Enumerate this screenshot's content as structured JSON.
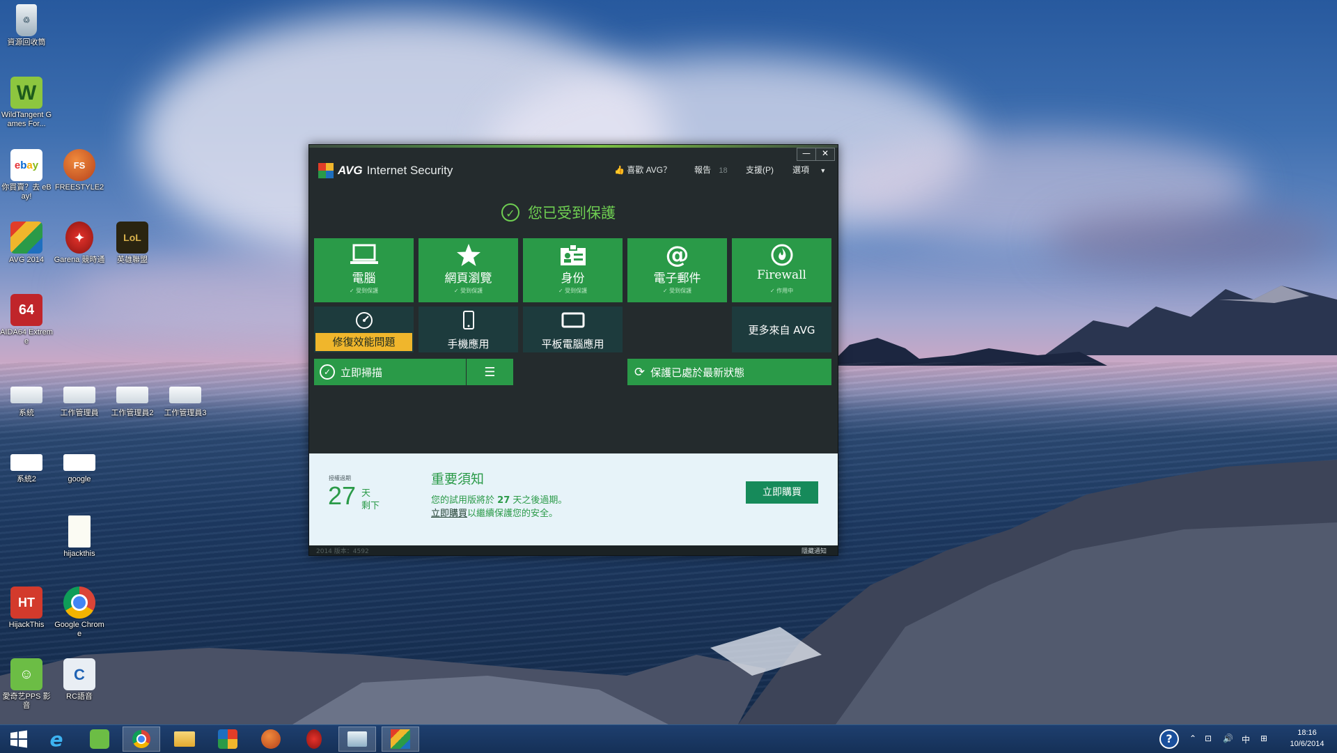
{
  "desktop_icons": [
    {
      "label": "資源回收筒",
      "icon": "recycle-bin-icon"
    },
    {
      "label": "WildTangent Games For...",
      "icon": "wildtangent-icon"
    },
    {
      "label": "你買賣？去 eBay!",
      "icon": "ebay-icon"
    },
    {
      "label": "FREESTYLE2",
      "icon": "freestyle-icon"
    },
    {
      "label": "AVG 2014",
      "icon": "avg-icon"
    },
    {
      "label": "Garena 競時通",
      "icon": "garena-icon"
    },
    {
      "label": "英雄聯盟",
      "icon": "league-icon"
    },
    {
      "label": "AIDA64 Extreme",
      "icon": "aida64-icon"
    },
    {
      "label": "系統",
      "icon": "shortcut-icon"
    },
    {
      "label": "工作管理員",
      "icon": "shortcut-icon"
    },
    {
      "label": "工作管理員2",
      "icon": "shortcut-icon"
    },
    {
      "label": "工作管理員3",
      "icon": "shortcut-icon"
    },
    {
      "label": "系統2",
      "icon": "shortcut-icon"
    },
    {
      "label": "google",
      "icon": "shortcut-icon"
    },
    {
      "label": "hijackthis",
      "icon": "text-file-icon"
    },
    {
      "label": "HijackThis",
      "icon": "hijackthis-icon"
    },
    {
      "label": "Google Chrome",
      "icon": "chrome-icon"
    },
    {
      "label": "愛奇艺PPS 影音",
      "icon": "iqiyi-icon"
    },
    {
      "label": "RC語音",
      "icon": "rc-icon"
    }
  ],
  "avg_window": {
    "brand": "AVG",
    "product": "Internet Security",
    "menu": {
      "like": "喜歡 AVG？",
      "reports": "報告",
      "reports_count": "18",
      "support": "支援(P)",
      "options": "選項"
    },
    "window_buttons": {
      "minimize": "—",
      "close": "✕"
    },
    "status": "您已受到保護",
    "tiles": [
      {
        "title": "電腦",
        "status": "受到保護",
        "icon": "computer-icon"
      },
      {
        "title": "網頁瀏覽",
        "status": "受到保護",
        "icon": "star-icon"
      },
      {
        "title": "身份",
        "status": "受到保護",
        "icon": "identity-icon"
      },
      {
        "title": "電子郵件",
        "status": "受到保護",
        "icon": "at-icon"
      },
      {
        "title": "Firewall",
        "status": "作用中",
        "icon": "flame-icon"
      }
    ],
    "secondary": [
      {
        "title": "修復效能問題",
        "icon": "speedometer-icon"
      },
      {
        "title": "手機應用",
        "icon": "phone-icon"
      },
      {
        "title": "平板電腦應用",
        "icon": "tablet-icon"
      },
      {
        "title": "更多來自 AVG",
        "icon": ""
      }
    ],
    "scan_now": "立即掃描",
    "update_status": "保護已處於最新狀態",
    "notice": {
      "small_label": "授權過期",
      "days": "27",
      "days_unit": "天",
      "remaining": "剩下",
      "title": "重要須知",
      "line1_a": "您的試用版將於",
      "line1_days": "27",
      "line1_b": "天之後過期。",
      "buy_link": "立即購買",
      "line2_rest": "以繼續保護您的安全。",
      "buy_button": "立即購買"
    },
    "footer_left": "2014 版本：4592",
    "footer_right": "隱藏通知"
  },
  "taskbar": {
    "apps": [
      {
        "name": "ie-icon"
      },
      {
        "name": "iqiyi-icon"
      },
      {
        "name": "chrome-icon"
      },
      {
        "name": "file-explorer-icon"
      },
      {
        "name": "puzzle-app-icon"
      },
      {
        "name": "freestyle-icon"
      },
      {
        "name": "garena-icon"
      },
      {
        "name": "task-manager-icon"
      },
      {
        "name": "avg-icon"
      }
    ],
    "ime": "中",
    "time": "18:16",
    "date": "10/6/2014"
  },
  "colors": {
    "avg_green": "#2a9a48",
    "avg_dark": "#242b2d",
    "protected_green": "#6fcf52",
    "warning_yellow": "#f0b62c",
    "notice_bg": "#e7f3f9"
  }
}
